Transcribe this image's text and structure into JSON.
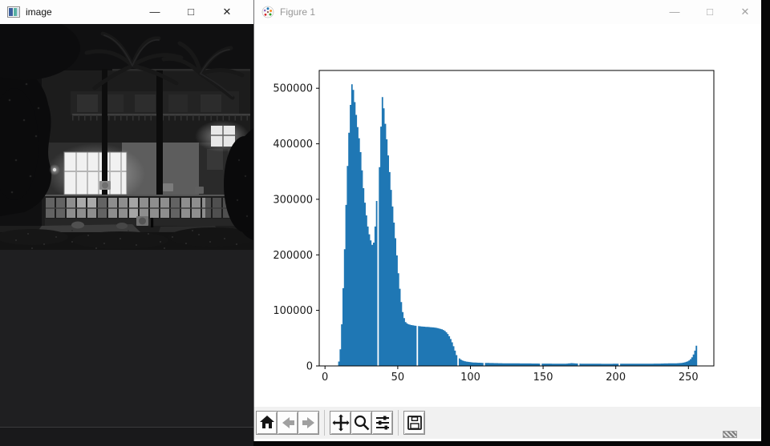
{
  "cv_window": {
    "title": "image",
    "controls": {
      "minimize": "—",
      "maximize": "□",
      "close": "✕"
    }
  },
  "mpl_window": {
    "title": "Figure 1",
    "controls": {
      "minimize": "—",
      "maximize": "□",
      "close": "✕"
    },
    "toolbar": {
      "buttons": [
        "home",
        "back",
        "forward",
        "pan",
        "zoom",
        "configure-subplots",
        "save"
      ]
    }
  },
  "icons": {
    "image-app-icon": "small framed picture glyph",
    "matplotlib-logo-icon": "colorful polar scatter logo",
    "home-icon": "black house",
    "back-icon": "gray left arrow",
    "forward-icon": "gray right arrow",
    "pan-icon": "four-direction move arrows",
    "zoom-icon": "magnifier",
    "configure-subplots-icon": "slider lines",
    "save-icon": "floppy disk",
    "minimize-icon": "—",
    "maximize-icon": "□",
    "close-icon": "✕"
  },
  "chart_data": {
    "type": "bar",
    "title": "",
    "xlabel": "",
    "ylabel": "",
    "legend": null,
    "grid": false,
    "bar_color": "#1f77b4",
    "background": "#ffffff",
    "xlim": [
      -4,
      267.5
    ],
    "ylim": [
      0,
      532000
    ],
    "xticks": [
      0,
      50,
      100,
      150,
      200,
      250
    ],
    "yticks": [
      0,
      100000,
      200000,
      300000,
      400000,
      500000
    ],
    "x_start": 0,
    "bin_width": 1,
    "values": [
      0,
      0,
      0,
      0,
      0,
      0,
      0,
      0,
      0,
      8000,
      30000,
      75000,
      140000,
      210000,
      290000,
      360000,
      420000,
      470000,
      507000,
      497000,
      475000,
      452000,
      430000,
      410000,
      385000,
      352000,
      320000,
      294000,
      271000,
      251000,
      237000,
      226000,
      218000,
      222000,
      251000,
      297000,
      0,
      358000,
      431000,
      484000,
      464000,
      436000,
      408000,
      379000,
      349000,
      317000,
      287000,
      258000,
      230000,
      199000,
      167000,
      139000,
      115000,
      97000,
      86000,
      79000,
      76500,
      75000,
      74200,
      73600,
      73100,
      72700,
      72300,
      0,
      71800,
      71400,
      71100,
      70800,
      70600,
      70400,
      70200,
      70000,
      69800,
      69600,
      69300,
      69000,
      68600,
      68100,
      67500,
      66800,
      65900,
      64700,
      63000,
      60500,
      57500,
      53500,
      48500,
      42500,
      35500,
      27500,
      19500,
      0,
      13500,
      11500,
      10000,
      9000,
      8300,
      7800,
      7400,
      7000,
      6700,
      6400,
      6200,
      6000,
      5900,
      5800,
      5700,
      5600,
      5500,
      0,
      5400,
      5350,
      5300,
      5250,
      5200,
      5150,
      5100,
      5050,
      5000,
      4950,
      4900,
      4850,
      4800,
      4800,
      4750,
      4750,
      4700,
      4700,
      4650,
      4650,
      4600,
      4600,
      4550,
      4550,
      4500,
      4500,
      4500,
      4450,
      4450,
      4400,
      4400,
      4400,
      4350,
      4350,
      4300,
      4300,
      4300,
      4250,
      0,
      4250,
      4200,
      4200,
      4200,
      4150,
      4150,
      4150,
      4100,
      4100,
      4100,
      4100,
      4050,
      4050,
      4050,
      4000,
      4000,
      4100,
      4200,
      4400,
      4700,
      5000,
      4900,
      4600,
      4400,
      4300,
      0,
      4150,
      4100,
      4100,
      4050,
      4050,
      4000,
      4000,
      3950,
      3950,
      3900,
      3900,
      3900,
      3850,
      3850,
      3850,
      3800,
      3800,
      3800,
      3800,
      3750,
      3750,
      3750,
      3800,
      3850,
      3900,
      3950,
      4000,
      0,
      3950,
      3900,
      3900,
      3850,
      3850,
      3900,
      3900,
      3950,
      3950,
      3900,
      3900,
      3850,
      3850,
      3900,
      3900,
      3950,
      3950,
      4000,
      4000,
      4050,
      4050,
      4100,
      4100,
      4150,
      4150,
      4200,
      4200,
      4250,
      4300,
      4350,
      4400,
      4450,
      4500,
      4550,
      4600,
      4650,
      4700,
      4750,
      4800,
      4900,
      5000,
      5200,
      5500,
      5900,
      6500,
      7300,
      8400,
      10000,
      12200,
      15500,
      20500,
      27500,
      36500
    ]
  }
}
